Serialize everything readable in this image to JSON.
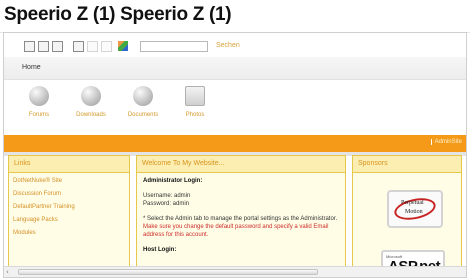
{
  "title": "Speerio Z (1) Speerio Z (1)",
  "toolbar": {
    "search_label": "Sechen"
  },
  "nav": {
    "home": "Home",
    "items": [
      {
        "label": "Forums",
        "icon": "forums-icon"
      },
      {
        "label": "Downloads",
        "icon": "downloads-icon"
      },
      {
        "label": "Documents",
        "icon": "documents-icon"
      },
      {
        "label": "Photos",
        "icon": "photos-icon"
      }
    ],
    "user_link": "AdminSite"
  },
  "links": {
    "title": "Links",
    "items": [
      "DotNetNuke® Site",
      "Discussion Forum",
      "DefaultPartner Training",
      "Language Packs",
      "Modules"
    ]
  },
  "welcome": {
    "title": "Welcome To My Website...",
    "admin_heading": "Administrator Login:",
    "username": "Username: admin",
    "password": "Password: admin",
    "note_black": "* Select the Admin tab to manage the portal settings as the Administrator.",
    "note_red": "Make sure you change the default password and specify a valid Email address for this account.",
    "host_heading": "Host Login:"
  },
  "sponsors": {
    "title": "Sponsors",
    "logo1_line1": "Perpetual",
    "logo1_line2": "Motion",
    "logo2_small": "Microsoft",
    "logo2_text": "ASP.net"
  },
  "colors": {
    "accent": "#f49a18",
    "panel_bg": "#fffde6",
    "link": "#d58f25",
    "warning": "#cc2b2b"
  }
}
